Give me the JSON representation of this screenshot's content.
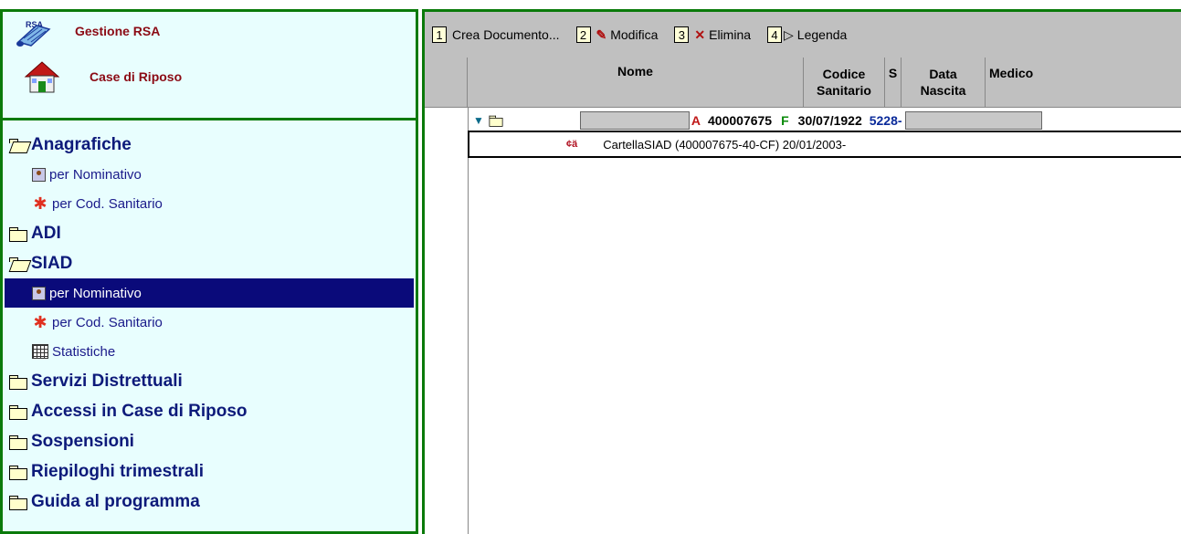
{
  "left_panel": {
    "rsa_small": "RSA",
    "links": [
      {
        "label": "Gestione RSA",
        "icon": "scroll-icon"
      },
      {
        "label": "Case di Riposo",
        "icon": "house-icon"
      }
    ],
    "tree": {
      "anagrafiche": "Anagrafiche",
      "anagrafiche_items": [
        "per Nominativo",
        "per Cod. Sanitario"
      ],
      "adi": "ADI",
      "siad": "SIAD",
      "siad_items": [
        "per Nominativo",
        "per Cod. Sanitario",
        "Statistiche"
      ],
      "servizi": "Servizi Distrettuali",
      "accessi": "Accessi in Case di Riposo",
      "sospensioni": "Sospensioni",
      "riepiloghi": "Riepiloghi trimestrali",
      "guida": "Guida al programma"
    }
  },
  "toolbar": {
    "items": [
      {
        "num": "1",
        "label": "Crea Documento..."
      },
      {
        "num": "2",
        "label": "Modifica"
      },
      {
        "num": "3",
        "label": "Elimina"
      },
      {
        "num": "4",
        "label": "Legenda"
      }
    ]
  },
  "grid": {
    "headers": {
      "nome": "Nome",
      "codice_1": "Codice",
      "codice_2": "Sanitario",
      "sesso": "S",
      "data_1": "Data",
      "data_2": "Nascita",
      "medico": "Medico"
    },
    "row": {
      "name_suffix": "A",
      "codice": "400007675",
      "sesso": "F",
      "data": "30/07/1922",
      "medico": "5228- /"
    },
    "sub_row": {
      "label": "CartellaSIAD (400007675-40-CF) 20/01/2003-"
    }
  },
  "colors": {
    "accent_green": "#0a7a0a",
    "panel_bg": "#e8fefe",
    "selection": "#0a0a7a",
    "link_red": "#8b0a14",
    "toolbar_gray": "#c0c0c0"
  }
}
